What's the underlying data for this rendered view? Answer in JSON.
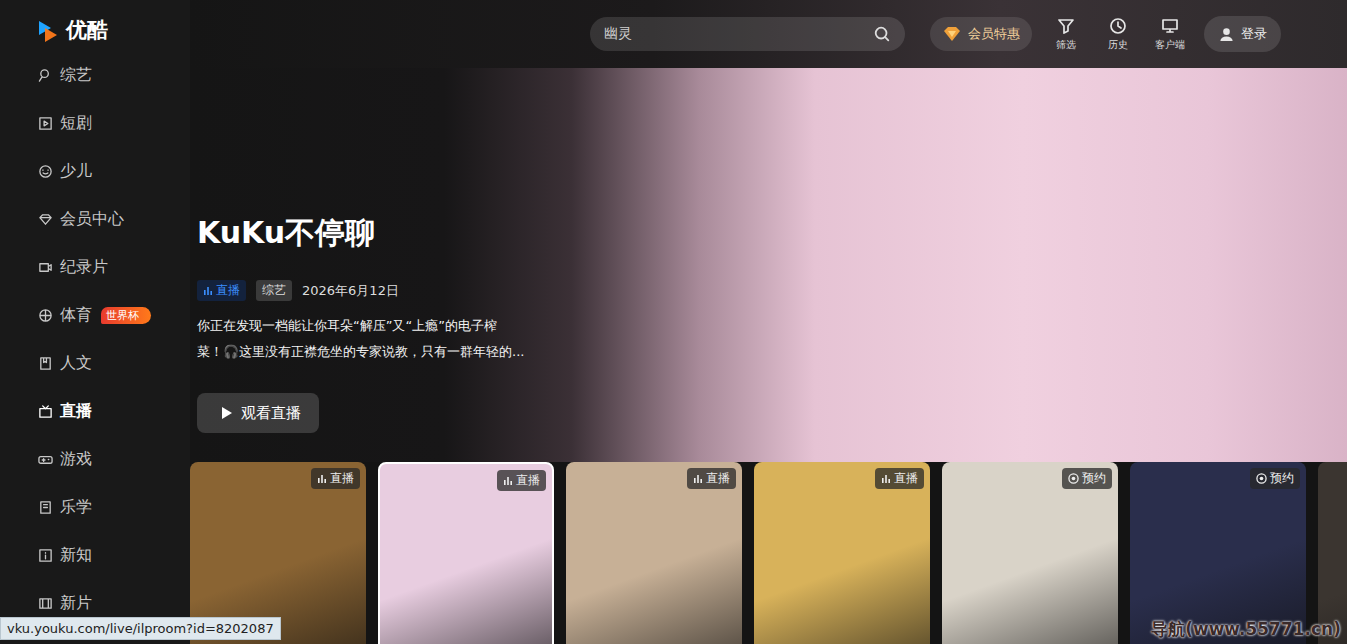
{
  "logo": {
    "text": "优酷"
  },
  "sidebar": {
    "items": [
      {
        "label": "综艺",
        "selected": false
      },
      {
        "label": "短剧",
        "selected": false
      },
      {
        "label": "少儿",
        "selected": false
      },
      {
        "label": "会员中心",
        "selected": false
      },
      {
        "label": "纪录片",
        "selected": false
      },
      {
        "label": "体育",
        "selected": false,
        "badge": "世界杯"
      },
      {
        "label": "人文",
        "selected": false
      },
      {
        "label": "直播",
        "selected": true
      },
      {
        "label": "游戏",
        "selected": false
      },
      {
        "label": "乐学",
        "selected": false
      },
      {
        "label": "新知",
        "selected": false
      },
      {
        "label": "新片",
        "selected": false
      }
    ]
  },
  "topbar": {
    "search": {
      "value": "幽灵"
    },
    "vip": "会员特惠",
    "tools": [
      {
        "label": "筛选"
      },
      {
        "label": "历史"
      },
      {
        "label": "客户端"
      }
    ],
    "login": "登录"
  },
  "hero": {
    "title": "KuKu不停聊",
    "live_tag": "直播",
    "category": "综艺",
    "date": "2026年6月12日",
    "description": [
      "你正在发现一档能让你耳朵“解压”又“上瘾”的电子榨",
      "菜！🎧这里没有正襟危坐的专家说教，只有一群年轻的..."
    ],
    "button": "观看直播"
  },
  "cards": [
    {
      "badge": "直播",
      "kind": "live",
      "selected": false,
      "color": "#8a6433"
    },
    {
      "badge": "直播",
      "kind": "live",
      "selected": true,
      "color": "#e8cde0"
    },
    {
      "badge": "直播",
      "kind": "live",
      "selected": false,
      "color": "#c7b096"
    },
    {
      "badge": "直播",
      "kind": "live",
      "selected": false,
      "color": "#d8b25a"
    },
    {
      "badge": "预约",
      "kind": "reserve",
      "selected": false,
      "color": "#d9d3c8"
    },
    {
      "badge": "预约",
      "kind": "reserve",
      "selected": false,
      "color": "#2a2e4c"
    },
    {
      "kind": "none",
      "selected": false,
      "color": "#3b3530"
    }
  ],
  "status_bar": {
    "url": "vku.youku.com/live/ilproom?id=8202087"
  },
  "watermark": "导航(www.55771.cn)"
}
